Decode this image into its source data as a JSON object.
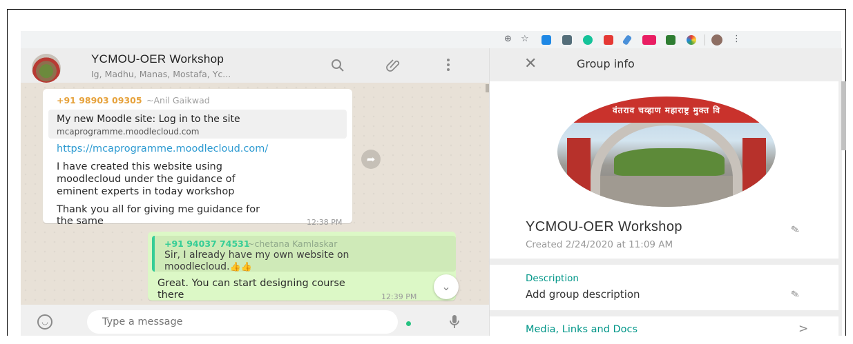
{
  "toolbar": {
    "icons": [
      "zoom-icon",
      "star-icon",
      "ext-drive-icon",
      "ext-reader-icon",
      "ext-grammarly-icon",
      "ext-gmail-icon",
      "ext-pen-icon",
      "ext-translate-icon",
      "ext-green-icon",
      "ext-color-icon",
      "profile-avatar",
      "menu-kebab-icon"
    ],
    "zoom_glyph": "⊕",
    "star_glyph": "☆",
    "menu_glyph": "⋮"
  },
  "chat": {
    "title": "YCMOU-OER Workshop",
    "members": "Ig, Madhu, Manas, Mostafa, Yc...",
    "messages": {
      "incoming": {
        "phone": "+91 98903 09305",
        "name": "~Anil Gaikwad",
        "preview_title": "My new Moodle site: Log in to the site",
        "preview_url": "mcaprogramme.moodlecloud.com",
        "link": "https://mcaprogramme.moodlecloud.com/",
        "line1": "I have created this website using",
        "line2": "moodlecloud under the guidance of",
        "line3": "eminent experts in today workshop",
        "line4": "Thank you all for giving me guidance for",
        "line5": "the same",
        "time": "12:38 PM"
      },
      "outgoing": {
        "quote_phone": "+91 94037 74531",
        "quote_name": "~chetana Kamlaskar",
        "quote_line1": "Sir, I already have my own website on",
        "quote_line2": "moodlecloud.",
        "quote_emoji": "👍👍",
        "line1": "Great. You can start designing course",
        "line2": "there",
        "time": "12:39 PM"
      }
    },
    "composer": {
      "placeholder": "Type a message"
    }
  },
  "info": {
    "header_title": "Group info",
    "group_name": "YCMOU-OER Workshop",
    "created": "Created 2/24/2020 at 11:09 AM",
    "description_label": "Description",
    "description_value": "Add group description",
    "media_label": "Media, Links and Docs",
    "photo_sign": "वंतराव चव्हाण महाराष्ट्र मुक्त वि"
  },
  "colors": {
    "accent": "#009688",
    "outgoing_bubble": "#dcf8c6",
    "incoming_sender": "#e6a23c",
    "link": "#2c9ad1"
  }
}
